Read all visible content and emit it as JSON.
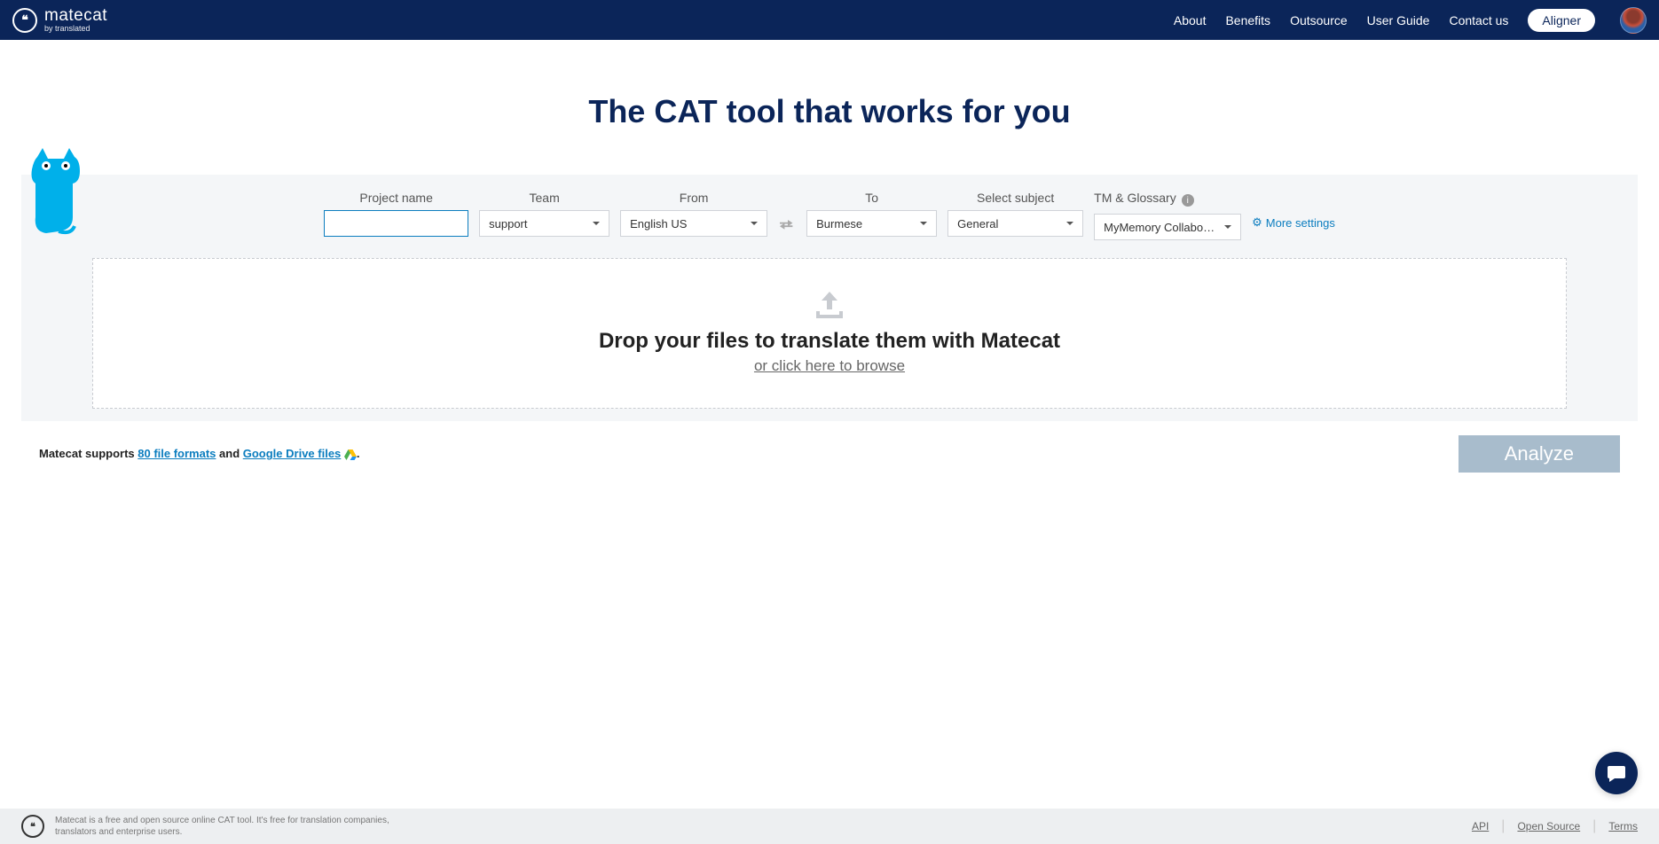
{
  "header": {
    "brand": "matecat",
    "brand_sub": "by translated",
    "nav": {
      "about": "About",
      "benefits": "Benefits",
      "outsource": "Outsource",
      "user_guide": "User Guide",
      "contact": "Contact us",
      "aligner": "Aligner"
    }
  },
  "hero": {
    "title": "The CAT tool that works for you"
  },
  "fields": {
    "project_name": {
      "label": "Project name",
      "value": ""
    },
    "team": {
      "label": "Team",
      "value": "support"
    },
    "from": {
      "label": "From",
      "value": "English US"
    },
    "to": {
      "label": "To",
      "value": "Burmese"
    },
    "subject": {
      "label": "Select subject",
      "value": "General"
    },
    "tm": {
      "label": "TM & Glossary",
      "value": "MyMemory Collabora..."
    },
    "more_settings": "More settings"
  },
  "drop": {
    "title": "Drop your files to translate them with Matecat",
    "sub": "or click here to browse"
  },
  "support": {
    "prefix": "Matecat supports ",
    "formats_link": "80 file formats",
    "mid": " and ",
    "drive_link": "Google Drive files"
  },
  "analyze": "Analyze",
  "footer": {
    "text": "Matecat is a free and open source online CAT tool. It's free for translation companies, translators and enterprise users.",
    "links": {
      "api": "API",
      "open_source": "Open Source",
      "terms": "Terms"
    }
  }
}
